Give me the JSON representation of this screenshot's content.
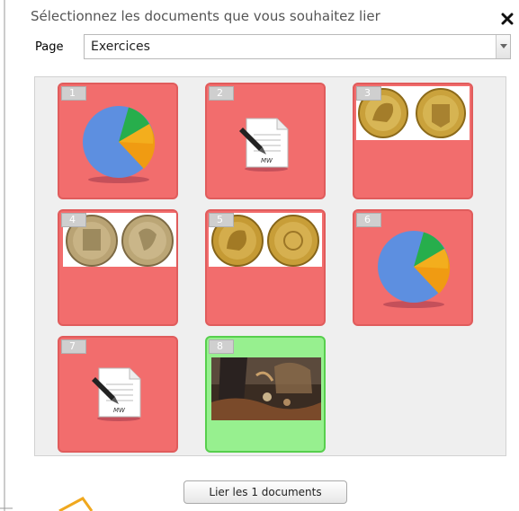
{
  "dialog": {
    "title": "Sélectionnez les documents que vous souhaitez lier"
  },
  "page_selector": {
    "label": "Page",
    "value": "Exercices"
  },
  "documents": [
    {
      "number": "1",
      "kind": "pie-chart",
      "selected": false
    },
    {
      "number": "2",
      "kind": "text-document",
      "selected": false
    },
    {
      "number": "3",
      "kind": "gold-coins",
      "selected": false
    },
    {
      "number": "4",
      "kind": "medals",
      "selected": false
    },
    {
      "number": "5",
      "kind": "gold-coins",
      "selected": false
    },
    {
      "number": "6",
      "kind": "pie-chart",
      "selected": false
    },
    {
      "number": "7",
      "kind": "text-document",
      "selected": false
    },
    {
      "number": "8",
      "kind": "painting",
      "selected": true
    }
  ],
  "link_button": {
    "label": "Lier les 1 documents"
  },
  "colors": {
    "unselected_tile": "#f26d6d",
    "selected_tile": "#97f08f",
    "panel": "#efefef"
  }
}
